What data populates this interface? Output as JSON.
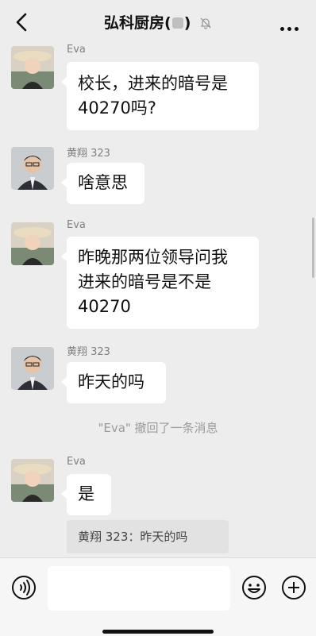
{
  "header": {
    "title": "弘科厨房(",
    "title_suffix": ")",
    "back_icon": "chevron-left-icon",
    "muted_icon": "bell-off-icon",
    "more_icon": "more-dots-icon"
  },
  "messages": [
    {
      "sender": "Eva",
      "text": "校长，进来的暗号是\n40270吗?"
    },
    {
      "sender": "黄翔 323",
      "text": "啥意思"
    },
    {
      "sender": "Eva",
      "text": "昨晚那两位领导问我\n进来的暗号是不是\n40270"
    },
    {
      "sender": "黄翔 323",
      "text": "昨天的吗"
    },
    {
      "sender": "Eva",
      "text": "是"
    }
  ],
  "system_message": "\"Eva\" 撤回了一条消息",
  "quote": "黄翔 323：昨天的吗",
  "inputbar": {
    "voice_icon": "voice-icon",
    "emoji_icon": "emoji-icon",
    "plus_icon": "plus-icon"
  },
  "colors": {
    "background": "#ededed",
    "bubble": "#ffffff",
    "text": "#111111",
    "muted_text": "#808080"
  }
}
